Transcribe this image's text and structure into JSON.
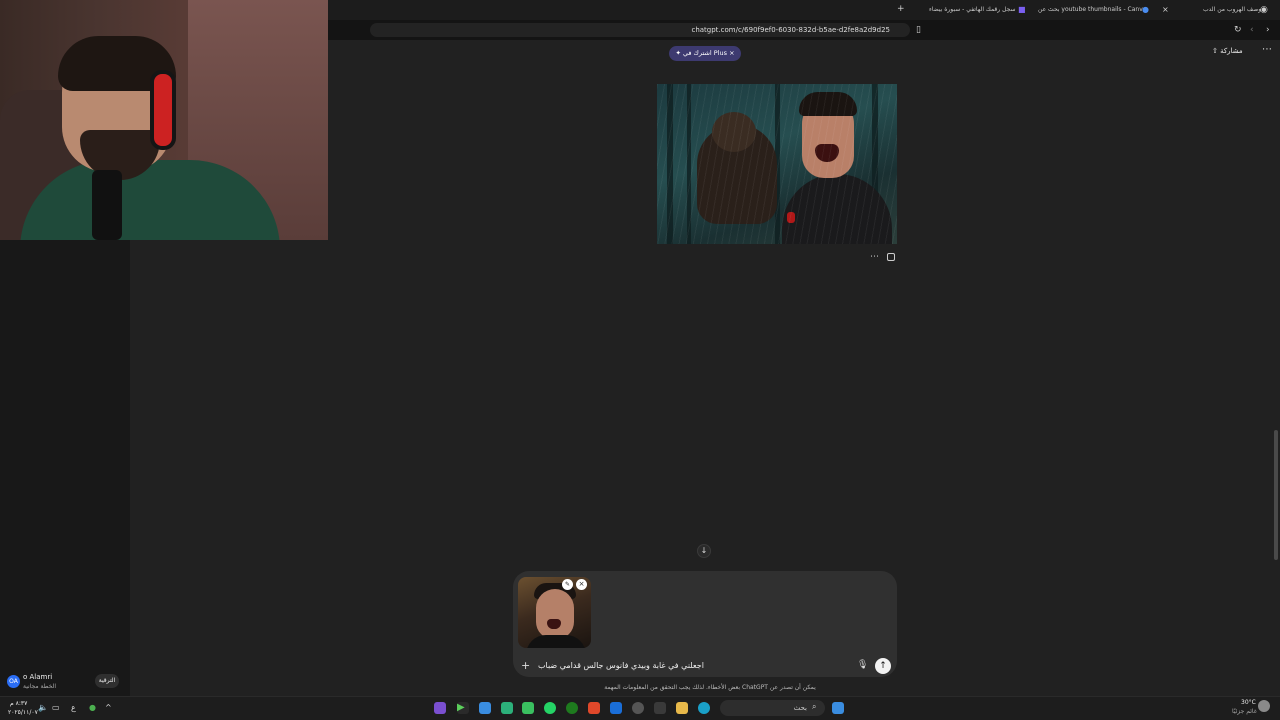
{
  "webcam": {},
  "browser": {
    "tabs": [
      {
        "label": "وصف الهروب من الدب"
      },
      {
        "label": "بحث عن youtube thumbnails - Canva"
      },
      {
        "label": "سجل رقمك الهاتفي - سبورة بيضاء"
      }
    ],
    "new_tab": "+",
    "url": "chatgpt.com/c/690f9ef0-6030-832d-b5ae-d2fe8a2d9d25"
  },
  "chat": {
    "plus_banner": "اشترك في Plus",
    "plus_close": "×",
    "share_label": "مشاركة",
    "more": "⋯",
    "image_more": "⋯",
    "scroll_down": "↓",
    "composer": {
      "prompt_text": "اجعلني في غابة وبيدي فانوس جالس قدامي ضباب",
      "plus": "+",
      "send": "↑",
      "mic": "🎙",
      "thumb_edit": "✎",
      "thumb_close": "×"
    },
    "disclaimer": "بعض الأخطاء. لذلك يجب التحقق من المعلومات المهمة ChatGPT يمكن أن تصدر عن"
  },
  "sidebar": {
    "avatar_initials": "OA",
    "user_name": "o Alamri",
    "plan": "الخطة مجانية",
    "upgrade": "الترقية"
  },
  "taskbar": {
    "search_placeholder": "بحث",
    "weather_temp": "30°C",
    "weather_desc": "غائم جزئيًا",
    "time": "٨:٣٧ م",
    "date": "٢٠٢٥/١١/٠٧",
    "lang": "ع"
  },
  "colors": {
    "background": "#212121",
    "composer": "#303030",
    "plus_pill": "#3d3a70"
  }
}
